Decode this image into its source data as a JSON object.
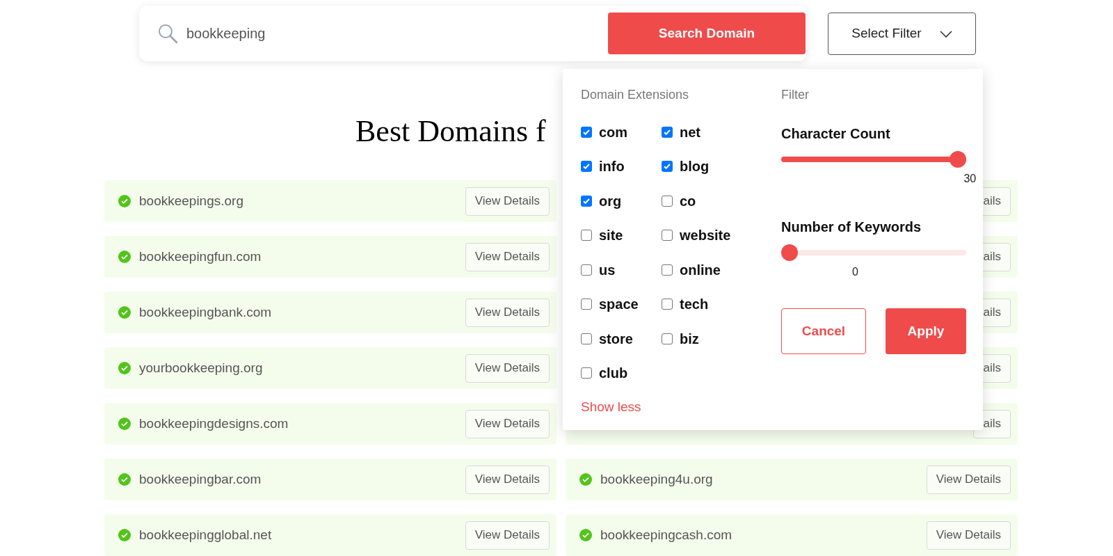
{
  "search": {
    "value": "bookkeeping",
    "button": "Search Domain"
  },
  "filter_button": "Select Filter",
  "heading": "Best Domains f",
  "rows": [
    {
      "left": {
        "name": "bookkeepings.org",
        "button": "View Details"
      },
      "right": {
        "button": "ails"
      }
    },
    {
      "left": {
        "name": "bookkeepingfun.com",
        "button": "View Details"
      },
      "right": {
        "button": "ails"
      }
    },
    {
      "left": {
        "name": "bookkeepingbank.com",
        "button": "View Details"
      },
      "right": {
        "button": "ails"
      }
    },
    {
      "left": {
        "name": "yourbookkeeping.org",
        "button": "View Details"
      },
      "right": {
        "button": "ails"
      }
    },
    {
      "left": {
        "name": "bookkeepingdesigns.com",
        "button": "View Details"
      },
      "right": {
        "button": "ails"
      }
    },
    {
      "left": {
        "name": "bookkeepingbar.com",
        "button": "View Details"
      },
      "right": {
        "name": "bookkeeping4u.org",
        "button": "View Details"
      }
    },
    {
      "left": {
        "name": "bookkeepingglobal.net",
        "button": "View Details"
      },
      "right": {
        "name": "bookkeepingcash.com",
        "button": "View Details"
      }
    }
  ],
  "filter_panel": {
    "extensions_title": "Domain Extensions",
    "extensions": [
      {
        "label": "com",
        "checked": true
      },
      {
        "label": "net",
        "checked": true
      },
      {
        "label": "info",
        "checked": true
      },
      {
        "label": "blog",
        "checked": true
      },
      {
        "label": "org",
        "checked": true
      },
      {
        "label": "co",
        "checked": false
      },
      {
        "label": "site",
        "checked": false
      },
      {
        "label": "website",
        "checked": false
      },
      {
        "label": "us",
        "checked": false
      },
      {
        "label": "online",
        "checked": false
      },
      {
        "label": "space",
        "checked": false
      },
      {
        "label": "tech",
        "checked": false
      },
      {
        "label": "store",
        "checked": false
      },
      {
        "label": "biz",
        "checked": false
      },
      {
        "label": "club",
        "checked": false
      }
    ],
    "show_less": "Show less",
    "filter_title": "Filter",
    "sliders": [
      {
        "label": "Character Count",
        "level": 1,
        "reading": "30"
      },
      {
        "label": "Number of Keywords",
        "level": 0,
        "reading": "0"
      }
    ],
    "buttons": [
      {
        "label": "Cancel",
        "kind": "outline"
      },
      {
        "label": "Apply",
        "kind": "solid"
      }
    ]
  }
}
